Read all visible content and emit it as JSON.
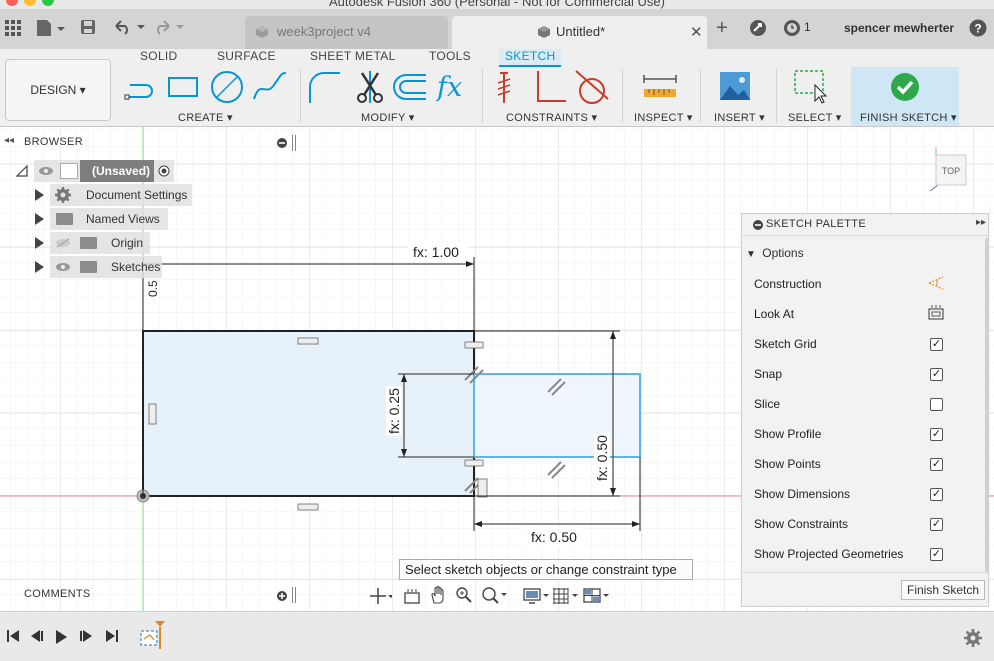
{
  "window": {
    "title": "Autodesk Fusion 360 (Personal - Not for Commercial Use)"
  },
  "tabs": [
    {
      "label": "week3project v4",
      "active": false
    },
    {
      "label": "Untitled*",
      "active": true
    }
  ],
  "header_right": {
    "job_count": "1",
    "user": "spencer mewherter",
    "help": "?"
  },
  "ribbon": {
    "workspace": "DESIGN ▾",
    "tabs": [
      "SOLID",
      "SURFACE",
      "SHEET METAL",
      "TOOLS",
      "SKETCH"
    ],
    "active_tab": "SKETCH",
    "groups": {
      "create": "CREATE ▾",
      "modify": "MODIFY ▾",
      "constraints": "CONSTRAINTS ▾",
      "inspect": "INSPECT ▾",
      "insert": "INSERT ▾",
      "select": "SELECT ▾",
      "finish": "FINISH SKETCH ▾"
    },
    "fx_glyph": "fx"
  },
  "browser": {
    "title": "BROWSER",
    "root": "(Unsaved)",
    "items": [
      "Document Settings",
      "Named Views",
      "Origin",
      "Sketches"
    ]
  },
  "canvas": {
    "view_cube_label": "TOP",
    "dimensions": {
      "top_width": "fx: 1.00",
      "left_height": "0.5",
      "inner_height": "fx: 0.25",
      "right_height": "fx: 0.50",
      "bottom_width": "fx: 0.50"
    }
  },
  "palette": {
    "title": "SKETCH PALETTE",
    "section": "Options",
    "rows": [
      {
        "label": "Construction",
        "type": "icon",
        "icon": "construction-icon"
      },
      {
        "label": "Look At",
        "type": "icon",
        "icon": "look-at-icon"
      },
      {
        "label": "Sketch Grid",
        "type": "check",
        "checked": true
      },
      {
        "label": "Snap",
        "type": "check",
        "checked": true
      },
      {
        "label": "Slice",
        "type": "check",
        "checked": false
      },
      {
        "label": "Show Profile",
        "type": "check",
        "checked": true
      },
      {
        "label": "Show Points",
        "type": "check",
        "checked": true
      },
      {
        "label": "Show Dimensions",
        "type": "check",
        "checked": true
      },
      {
        "label": "Show Constraints",
        "type": "check",
        "checked": true
      },
      {
        "label": "Show Projected Geometries",
        "type": "check",
        "checked": true
      }
    ],
    "finish_button": "Finish Sketch",
    "check_glyph": "✓"
  },
  "tooltip": "Select sketch objects or change constraint type",
  "comments": {
    "title": "COMMENTS"
  },
  "colors": {
    "accent": "#0696d7",
    "profile_fill": "#e6f1fa",
    "projected": "#5bb8e6",
    "finish_green": "#2ea84a",
    "origin_red": "#e48a8a",
    "origin_green": "#8fd08f"
  }
}
